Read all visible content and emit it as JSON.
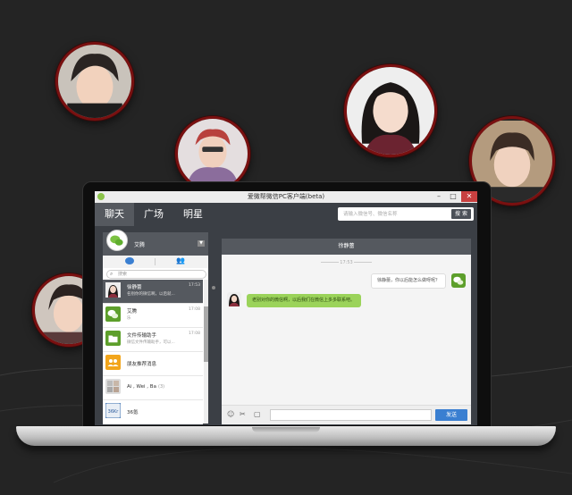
{
  "window": {
    "title": "爱微帮微信PC客户端(beta)",
    "min_label": "–",
    "max_label": "□",
    "close_label": "✕"
  },
  "nav": {
    "tabs": [
      {
        "label": "聊天"
      },
      {
        "label": "广场"
      },
      {
        "label": "明星"
      }
    ],
    "search_placeholder": "请输入微信号、微信名称",
    "search_button": "搜 索"
  },
  "profile": {
    "name": "艾腾"
  },
  "contact_search": {
    "placeholder": "搜索"
  },
  "contacts": [
    {
      "name": "徐静蕾",
      "preview": "名别你的微信啊，以后就...",
      "time": "17:53",
      "selected": true
    },
    {
      "name": "艾腾",
      "preview": "乐",
      "time": "17:08",
      "selected": false
    },
    {
      "name": "文件传输助手",
      "preview": "微信文件传输助手，可以...",
      "time": "17:08",
      "selected": false
    },
    {
      "name": "朋友推荐消息",
      "preview": "",
      "time": "",
      "selected": false
    },
    {
      "name": "Ai , Wei , Ba",
      "preview": "",
      "time": "",
      "count": "(3)",
      "selected": false
    },
    {
      "name": "36氪",
      "preview": "",
      "time": "",
      "selected": false
    }
  ],
  "chat": {
    "header": "徐静蕾",
    "timestamp": "17:53",
    "messages": [
      {
        "direction": "out",
        "text": "徐静蕾，你以后能怎么做呀呢？"
      },
      {
        "direction": "in",
        "text": "老别对你的微信啊，以后我们在微信上多多联系吧。"
      }
    ],
    "send_button": "发送"
  },
  "colors": {
    "background": "#242424",
    "nav_bg": "#3b3f45",
    "tab_active": "#55595f",
    "send_button": "#3a7fd1",
    "bubble_in": "#9bd35a",
    "avatar_border": "#7a1010"
  },
  "icons": [
    "chat-bubble-icon",
    "contacts-icon",
    "search-icon",
    "emoji-icon",
    "screenshot-icon",
    "folder-icon",
    "dropdown-icon"
  ]
}
